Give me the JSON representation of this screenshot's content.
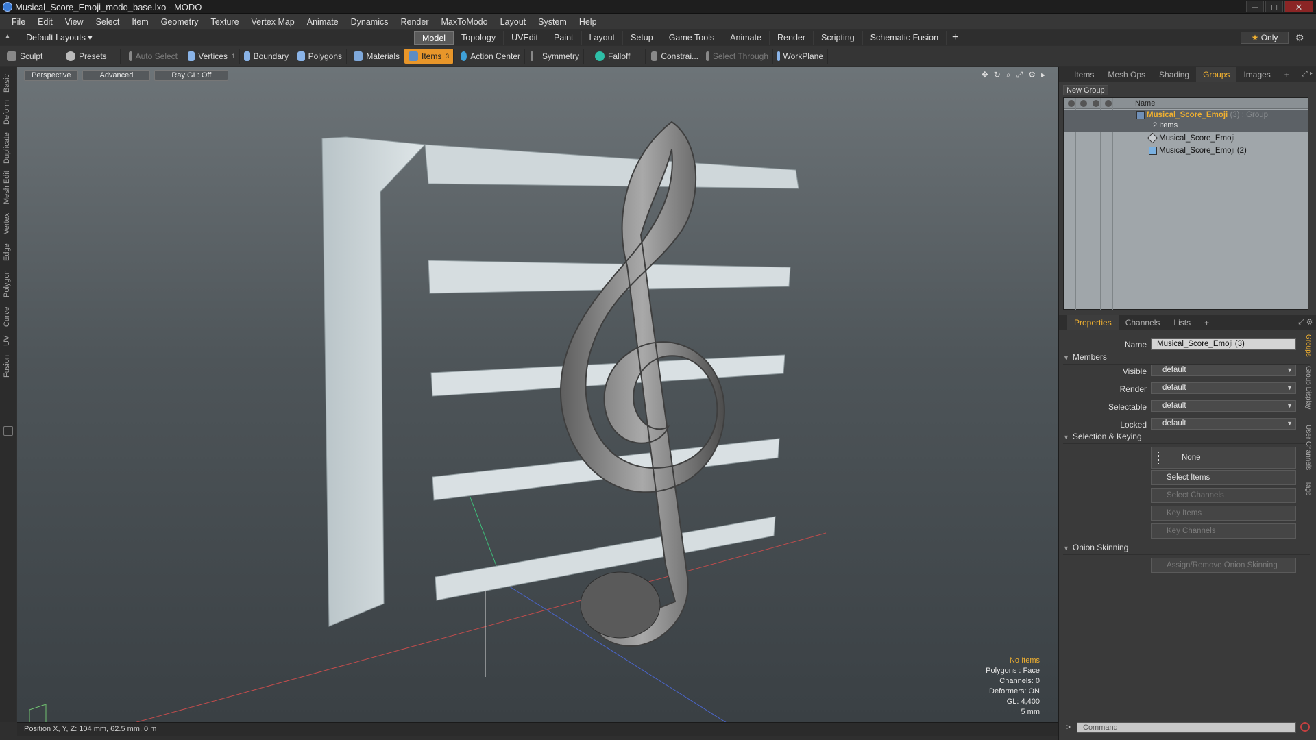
{
  "title": "Musical_Score_Emoji_modo_base.lxo - MODO",
  "window_controls": [
    "─",
    "□",
    "✕"
  ],
  "menu": [
    "File",
    "Edit",
    "View",
    "Select",
    "Item",
    "Geometry",
    "Texture",
    "Vertex Map",
    "Animate",
    "Dynamics",
    "Render",
    "MaxToModo",
    "Layout",
    "System",
    "Help"
  ],
  "layouts_label": "Default Layouts ▾",
  "mode_tabs": [
    "Model",
    "Topology",
    "UVEdit",
    "Paint",
    "Layout",
    "Setup",
    "Game Tools",
    "Animate",
    "Render",
    "Scripting",
    "Schematic Fusion"
  ],
  "active_mode": "Model",
  "only_label": "Only",
  "toolbar": {
    "sculpt": "Sculpt",
    "presets": "Presets",
    "auto_select": "Auto Select",
    "vertices": "Vertices",
    "vertices_count": "1",
    "boundary": "Boundary",
    "polygons": "Polygons",
    "materials": "Materials",
    "items": "Items",
    "items_count": "3",
    "action_center": "Action Center",
    "symmetry": "Symmetry",
    "falloff": "Falloff",
    "constraints": "Constrai...",
    "select_through": "Select Through",
    "workplane": "WorkPlane"
  },
  "left_tabs": [
    "Basic",
    "Deform",
    "Duplicate",
    "Mesh Edit",
    "Vertex",
    "Edge",
    "Polygon",
    "Curve",
    "UV",
    "Fusion"
  ],
  "viewport": {
    "tabs": [
      "Perspective",
      "Advanced",
      "Ray GL: Off"
    ],
    "info": {
      "items": "No Items",
      "polygons": "Polygons : Face",
      "channels": "Channels: 0",
      "deformers": "Deformers: ON",
      "gl": "GL: 4,400",
      "scale": "5 mm"
    }
  },
  "status": "Position X, Y, Z:  104 mm, 62.5 mm, 0 m",
  "top_panel": {
    "tabs": [
      "Items",
      "Mesh Ops",
      "Shading",
      "Groups",
      "Images"
    ],
    "active_tab": "Groups",
    "new_group": "New Group",
    "column_name": "Name",
    "group": {
      "name": "Musical_Score_Emoji",
      "suffix": "(3) : Group",
      "count": "2 Items",
      "children": [
        "Musical_Score_Emoji",
        "Musical_Score_Emoji (2)"
      ]
    }
  },
  "props_panel": {
    "tabs": [
      "Properties",
      "Channels",
      "Lists"
    ],
    "active_tab": "Properties",
    "name_label": "Name",
    "name_value": "Musical_Score_Emoji (3)",
    "members_section": "Members",
    "fields": [
      {
        "label": "Visible",
        "value": "default"
      },
      {
        "label": "Render",
        "value": "default"
      },
      {
        "label": "Selectable",
        "value": "default"
      },
      {
        "label": "Locked",
        "value": "default"
      }
    ],
    "selection_section": "Selection & Keying",
    "none_button": "None",
    "select_items": "Select Items",
    "select_channels": "Select Channels",
    "key_items": "Key Items",
    "key_channels": "Key Channels",
    "onion_section": "Onion Skinning",
    "onion_button": "Assign/Remove Onion Skinning",
    "side_tabs": [
      "Groups",
      "Group Display",
      "User Channels",
      "Tags"
    ]
  },
  "command_placeholder": "Command",
  "colors": {
    "accent": "#f0b030",
    "panel": "#3a3a3a",
    "viewport_top": "#6d7478"
  }
}
